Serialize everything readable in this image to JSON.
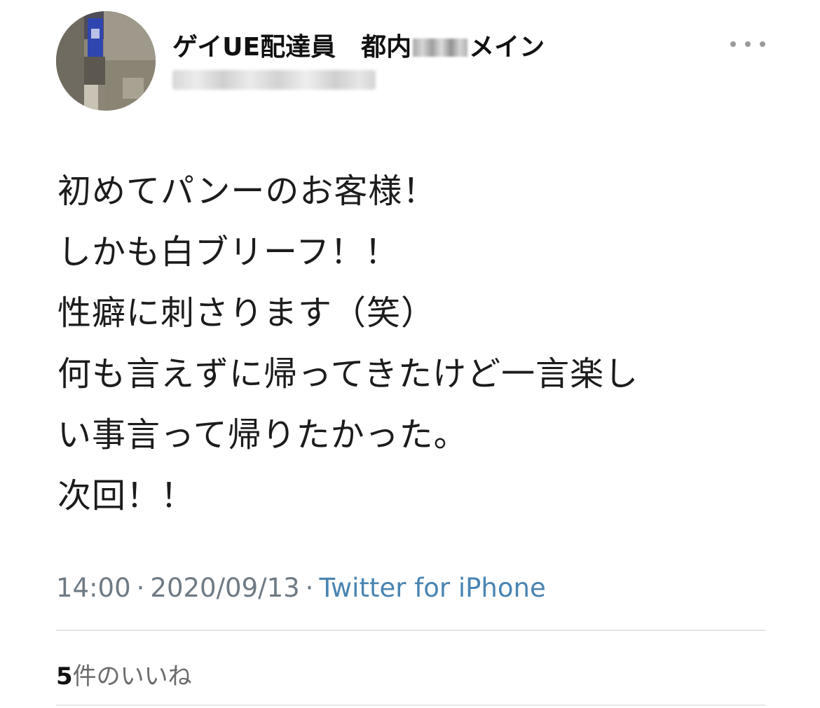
{
  "user": {
    "display_name_prefix": "ゲイUE配達員　都内",
    "display_name_suffix": "メイン",
    "avatar_colors": [
      "#5a5a6e",
      "#3a4fb8",
      "#8c8574",
      "#c6c2b5",
      "#6e6a60",
      "#a29d8f"
    ]
  },
  "actions": {
    "more_icon": "more-horizontal-icon"
  },
  "tweet": {
    "lines": [
      "初めてパンーのお客様！",
      "しかも白ブリーフ！！",
      "性癖に刺さります（笑）",
      "何も言えずに帰ってきたけど一言楽し",
      "い事言って帰りたかった。",
      "次回！！"
    ]
  },
  "meta": {
    "time": "14:00",
    "separator": "·",
    "date": "2020/09/13",
    "source": "Twitter for iPhone"
  },
  "stats": {
    "likes_count": "5",
    "likes_label": "件のいいね"
  },
  "colors": {
    "source_link": "#4a84b2",
    "meta_text": "#6e7a84",
    "divider": "#e3e6e8"
  }
}
